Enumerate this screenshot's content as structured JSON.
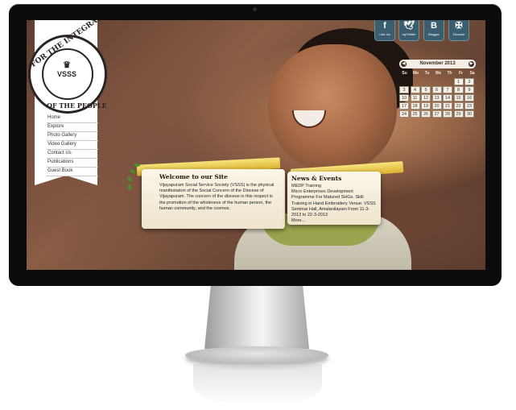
{
  "site": {
    "logo": {
      "ring_top": "FOR THE INTEGRAL GROWTH",
      "ring_bottom": "OF THE PEOPLE",
      "emblem": "VSSS"
    },
    "nav": [
      "Home",
      "Explore",
      "Photo Gallery",
      "Video Gallery",
      "Contact Us",
      "Publications",
      "Guest Book"
    ],
    "social": [
      {
        "icon": "facebook-icon",
        "glyph": "f",
        "label": "Like Us"
      },
      {
        "icon": "twitter-icon",
        "glyph": "🕊",
        "label": "myTwitter"
      },
      {
        "icon": "blogger-icon",
        "glyph": "B",
        "label": "Blogger"
      },
      {
        "icon": "diocese-icon",
        "glyph": "✠",
        "label": "Diocese"
      }
    ],
    "calendar": {
      "month": "November 2013",
      "weekdays": [
        "Su",
        "Mo",
        "Tu",
        "We",
        "Th",
        "Fr",
        "Sa"
      ],
      "first_weekday_index": 5,
      "days": 30
    },
    "welcome": {
      "title": "Welcome to our Site",
      "body": "Vijayapuram Social Service Society (VSSS) is the physical manifestation of the Social Concern of the Diocese of Vijayapuram. The concern of the diocese in this respect is the promotion of the wholeness of the human person, the human community, and the cosmos."
    },
    "news": {
      "title": "News & Events",
      "body": "MEDP Training\nMicro Enterprises Development Programme For Matured SHGs. Skill Training in Hand Embroidery Venue: VSSS Seminar Hall, Amalanilayam From 11-3-2013 to 22-3-2013",
      "more": "More..."
    }
  },
  "colors": {
    "monitor": "#0b0b0c",
    "ribbon_gold": "#dcb333",
    "panel_bg": "#fbf6e8",
    "social_bg": "#3a5e6f"
  }
}
